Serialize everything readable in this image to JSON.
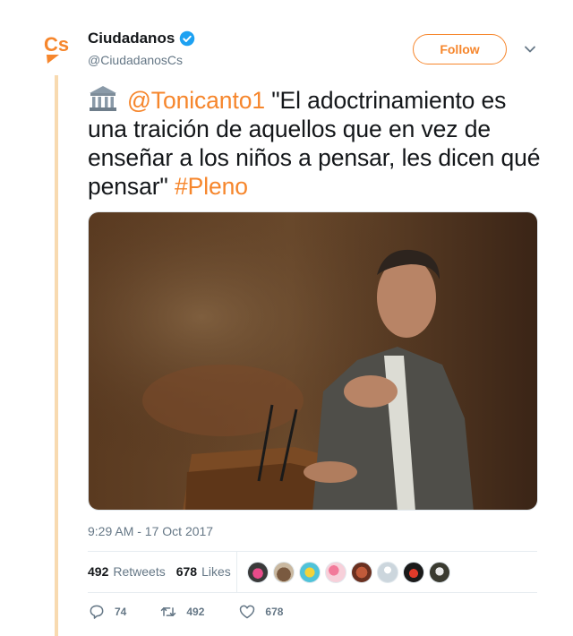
{
  "tweet": {
    "author": {
      "name": "Ciudadanos",
      "handle": "@CiudadanosCs",
      "verified": true,
      "logo_text": "Cs",
      "brand_color": "#f6862c"
    },
    "follow_label": "Follow",
    "text": {
      "emoji": "classical-building-icon",
      "mention": "@Tonicanto1",
      "body": " \"El adoctrinamiento es una traición de aquellos que en vez de enseñar a los niños a pensar, les dicen qué pensar\" ",
      "hashtag": "#Pleno"
    },
    "media": {
      "kind": "photo",
      "icon": "photo-speaker-at-podium"
    },
    "timestamp": "9:29 AM - 17 Oct 2017",
    "stats": {
      "retweets_count": "492",
      "retweets_label": "Retweets",
      "likes_count": "678",
      "likes_label": "Likes"
    },
    "liker_avatars": 8,
    "actions": {
      "reply_count": "74",
      "retweet_count": "492",
      "like_count": "678"
    },
    "colors": {
      "accent": "#f6862c",
      "thread_line": "#f8dab0",
      "verified": "#1da1f2",
      "secondary_text": "#657786"
    }
  }
}
